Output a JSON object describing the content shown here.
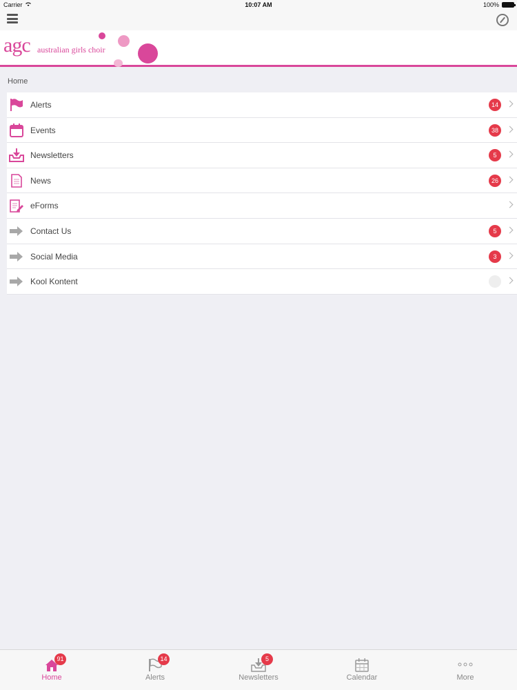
{
  "status_bar": {
    "carrier": "Carrier",
    "time": "10:07 AM",
    "battery": "100%"
  },
  "brand": {
    "logo_mark": "agc",
    "logo_text": "australian girls choir",
    "color": "#d9479a"
  },
  "breadcrumb": "Home",
  "menu": [
    {
      "label": "Alerts",
      "icon": "flag-icon",
      "badge": "14"
    },
    {
      "label": "Events",
      "icon": "calendar-icon",
      "badge": "38"
    },
    {
      "label": "Newsletters",
      "icon": "inbox-download-icon",
      "badge": "5"
    },
    {
      "label": "News",
      "icon": "document-icon",
      "badge": "26"
    },
    {
      "label": "eForms",
      "icon": "form-edit-icon",
      "badge": ""
    },
    {
      "label": "Contact Us",
      "icon": "arrow-right-icon",
      "badge": "5"
    },
    {
      "label": "Social Media",
      "icon": "arrow-right-icon",
      "badge": "3"
    },
    {
      "label": "Kool Kontent",
      "icon": "arrow-right-icon",
      "badge": ""
    }
  ],
  "tabs": [
    {
      "label": "Home",
      "icon": "home-icon",
      "badge": "91",
      "active": true
    },
    {
      "label": "Alerts",
      "icon": "flag-icon",
      "badge": "14"
    },
    {
      "label": "Newsletters",
      "icon": "inbox-download-icon",
      "badge": "5"
    },
    {
      "label": "Calendar",
      "icon": "calendar-icon",
      "badge": ""
    },
    {
      "label": "More",
      "icon": "more-dots-icon",
      "badge": ""
    }
  ],
  "colors": {
    "accent": "#d9479a",
    "badge": "#e53a4a",
    "background": "#efeff4"
  }
}
